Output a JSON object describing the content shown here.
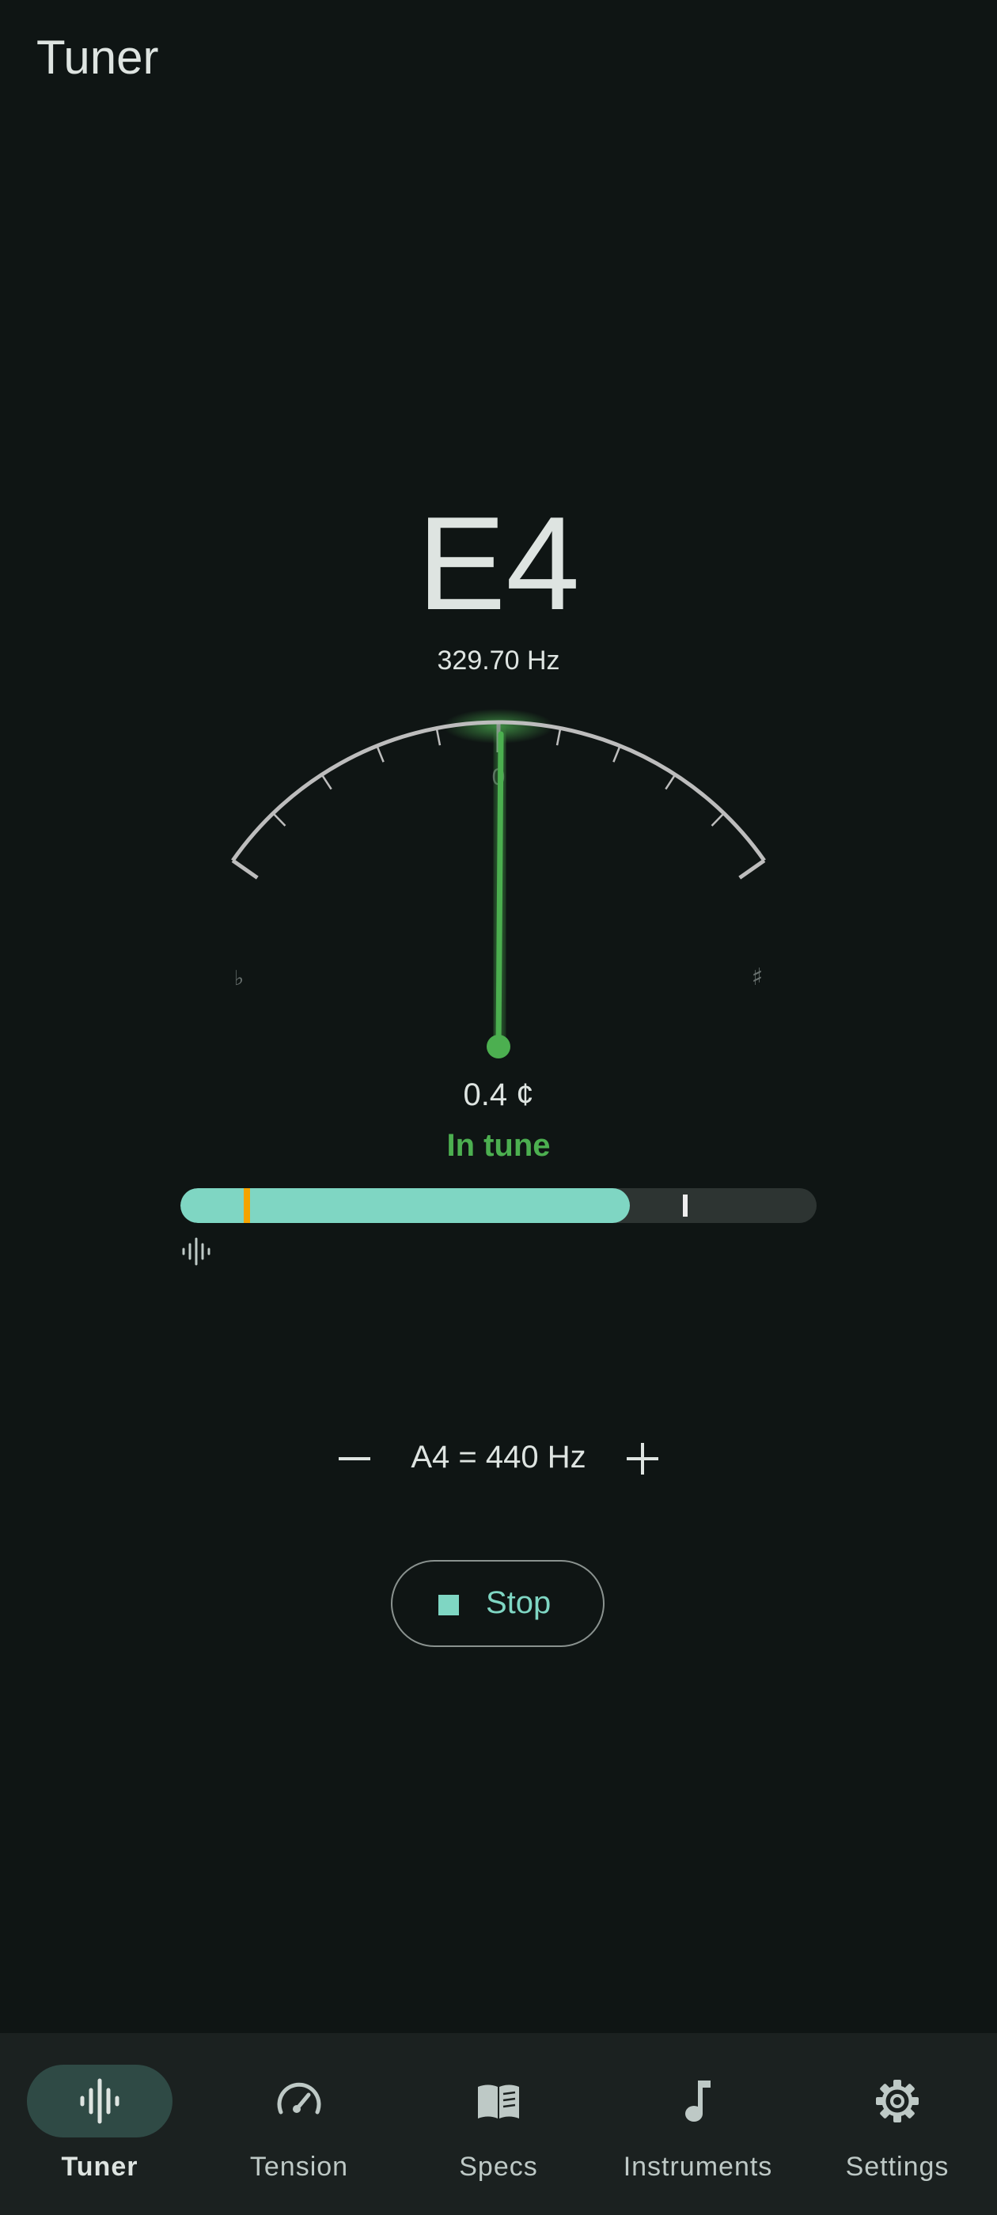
{
  "app": {
    "title": "Tuner"
  },
  "tuner": {
    "note": "E4",
    "frequency": "329.70 Hz",
    "cents_display": "0.4 ¢",
    "cents_value": 0.4,
    "status": "In tune",
    "gauge": {
      "center_label": "0",
      "flat_symbol": "♭",
      "sharp_symbol": "♯",
      "range_cents": 50
    },
    "input_level": {
      "level": 0.706,
      "threshold": 0.1,
      "peak": 0.79
    }
  },
  "reference": {
    "label": "A4 = 440 Hz",
    "decrease_icon": "minus-icon",
    "increase_icon": "plus-icon"
  },
  "controls": {
    "stop_label": "Stop",
    "stop_icon": "stop-icon"
  },
  "nav": {
    "items": [
      {
        "label": "Tuner",
        "icon": "waveform-icon",
        "active": true
      },
      {
        "label": "Tension",
        "icon": "gauge-icon",
        "active": false
      },
      {
        "label": "Specs",
        "icon": "book-icon",
        "active": false
      },
      {
        "label": "Instruments",
        "icon": "music-note-icon",
        "active": false
      },
      {
        "label": "Settings",
        "icon": "gear-icon",
        "active": false
      }
    ]
  },
  "colors": {
    "background": "#0f1514",
    "accent": "#7fd6c3",
    "in_tune": "#4caf50",
    "threshold": "#f5a300",
    "nav_background": "#1b2120",
    "nav_active_pill": "#2f4a45"
  }
}
